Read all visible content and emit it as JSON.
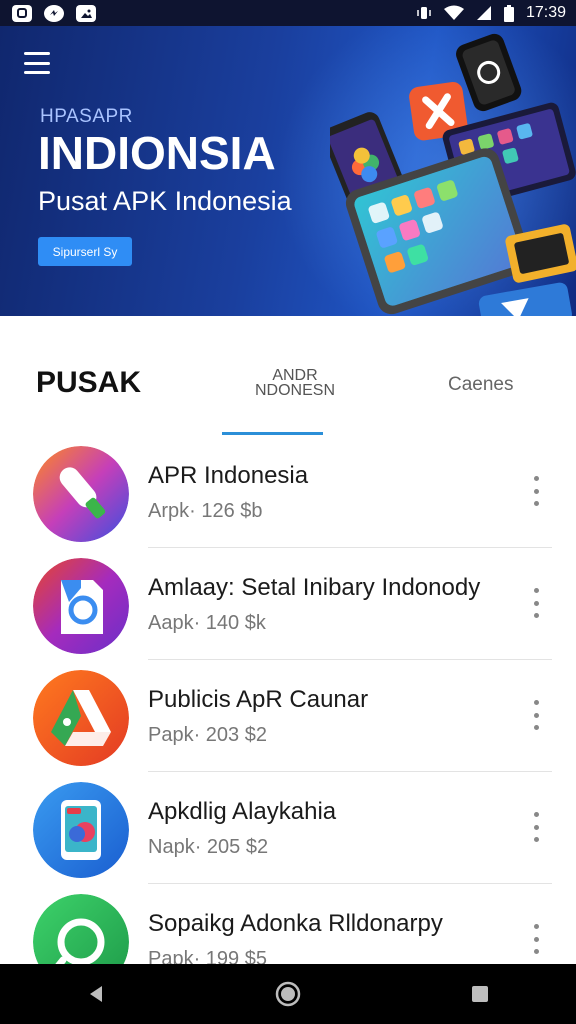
{
  "status_bar": {
    "time": "17:39",
    "left_icons": [
      "app-notification-icon",
      "messenger-icon",
      "image-icon"
    ],
    "right_icons": [
      "vibrate-icon",
      "wifi-icon",
      "signal-icon",
      "battery-icon"
    ]
  },
  "hero": {
    "overline": "HPASAPR",
    "title": "INDIONSIA",
    "subtitle": "Pusat APK Indonesia",
    "cta_label": "Sipurserl Sy",
    "menu_icon": "menu-icon"
  },
  "tabs": [
    {
      "label": "PUSAK",
      "active": true
    },
    {
      "label": "ANDR NDONESN",
      "active": false
    },
    {
      "label": "Caenes",
      "active": false
    }
  ],
  "apps": [
    {
      "name": "APR Indonesia",
      "meta": "Arpk· 126  $b",
      "icon": "app-icon-pen-orange-purple"
    },
    {
      "name": "Amlaay: Setal Inibary Indonody",
      "meta": "Aapk· 140  $k",
      "icon": "app-icon-file-purple"
    },
    {
      "name": "Publicis ApR  Caunar",
      "meta": "Papk· 203  $2",
      "icon": "app-icon-drive-orange"
    },
    {
      "name": "Apkdlig Alaykahia",
      "meta": "Napk· 205  $2",
      "icon": "app-icon-phone-blue"
    },
    {
      "name": "Sopaikg Adonka Rlldonarpy",
      "meta": "Papk· 199  $5",
      "icon": "app-icon-search-green"
    }
  ],
  "nav": {
    "back": "back-icon",
    "home": "home-icon",
    "recents": "recents-icon"
  },
  "colors": {
    "hero_bg": "#1a3f9e",
    "accent": "#2b8fd8",
    "cta": "#2f8df5"
  }
}
